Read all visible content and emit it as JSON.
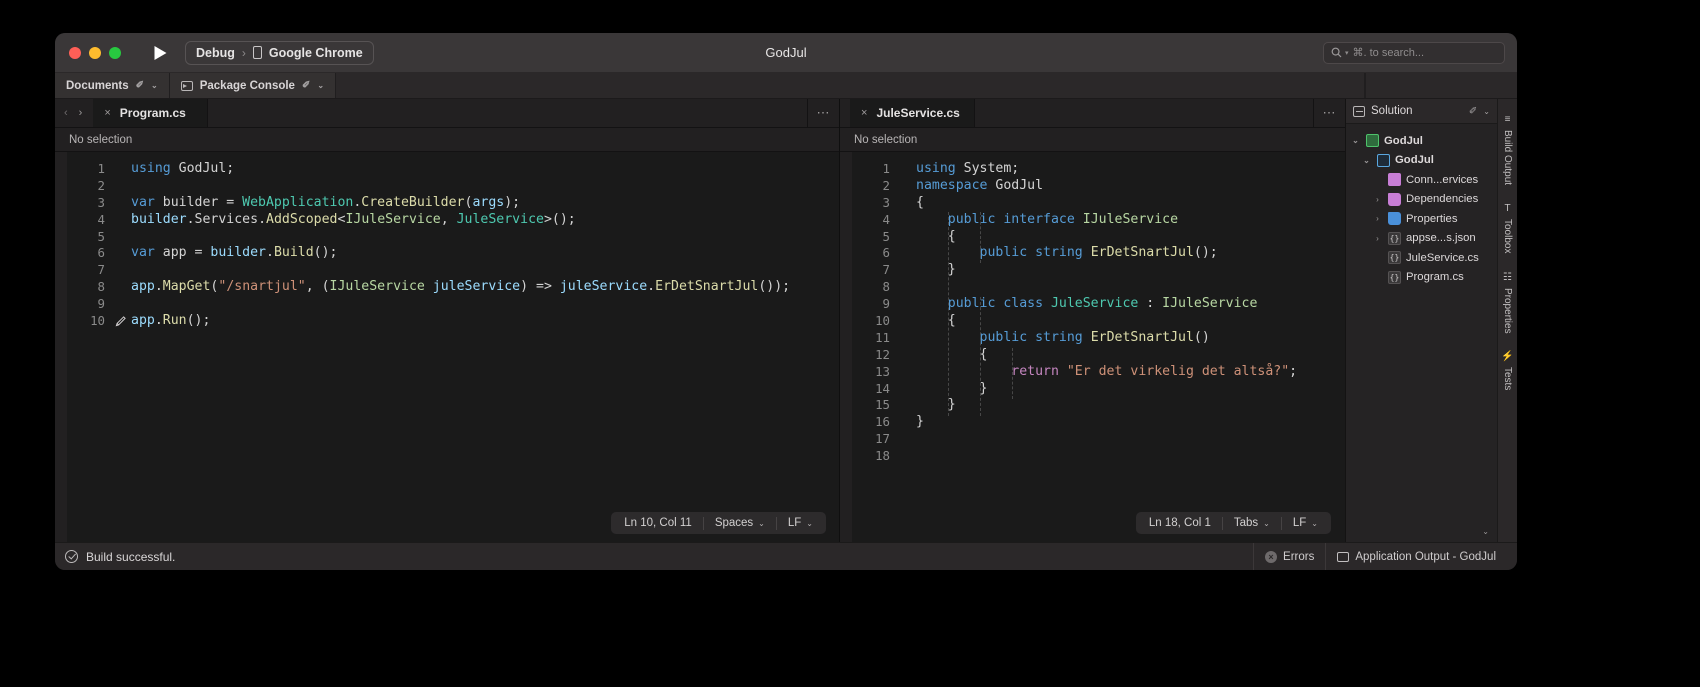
{
  "window": {
    "title": "GodJul",
    "run_button": "run-icon",
    "config": {
      "configuration": "Debug",
      "separator": "›",
      "target": "Google Chrome"
    },
    "search_placeholder": "⌘. to search..."
  },
  "pads": [
    {
      "label": "Documents",
      "icon": null,
      "pin": "✐",
      "chevron": "⌄"
    },
    {
      "label": "Package Console",
      "icon": "console-icon",
      "pin": "✐",
      "chevron": "⌄"
    }
  ],
  "panes": [
    {
      "tab": {
        "name": "Program.cs",
        "close": "×"
      },
      "breadcrumb": "No selection",
      "nav_back": "‹",
      "nav_forward": "›",
      "overflow": "⋯",
      "status": {
        "position": "Ln 10, Col 11",
        "indent": "Spaces",
        "eol": "LF",
        "chevron": "⌄"
      },
      "lines": [
        {
          "n": "1",
          "marker": "",
          "tokens": [
            {
              "t": "using ",
              "c": "kw"
            },
            {
              "t": "GodJul",
              "c": "pl"
            },
            {
              "t": ";",
              "c": "pl"
            }
          ]
        },
        {
          "n": "2",
          "marker": "",
          "tokens": []
        },
        {
          "n": "3",
          "marker": "",
          "tokens": [
            {
              "t": "var ",
              "c": "kw"
            },
            {
              "t": "builder",
              "c": "pl"
            },
            {
              "t": " = ",
              "c": "pl"
            },
            {
              "t": "WebApplication",
              "c": "typ"
            },
            {
              "t": ".",
              "c": "pl"
            },
            {
              "t": "CreateBuilder",
              "c": "mth"
            },
            {
              "t": "(",
              "c": "pl"
            },
            {
              "t": "args",
              "c": "par"
            },
            {
              "t": ");",
              "c": "pl"
            }
          ]
        },
        {
          "n": "4",
          "marker": "",
          "tokens": [
            {
              "t": "builder",
              "c": "par"
            },
            {
              "t": ".",
              "c": "pl"
            },
            {
              "t": "Services",
              "c": "pl"
            },
            {
              "t": ".",
              "c": "pl"
            },
            {
              "t": "AddScoped",
              "c": "mth"
            },
            {
              "t": "<",
              "c": "pl"
            },
            {
              "t": "IJuleService",
              "c": "ifc"
            },
            {
              "t": ", ",
              "c": "pl"
            },
            {
              "t": "JuleService",
              "c": "typ"
            },
            {
              "t": ">();",
              "c": "pl"
            }
          ]
        },
        {
          "n": "5",
          "marker": "",
          "tokens": []
        },
        {
          "n": "6",
          "marker": "",
          "tokens": [
            {
              "t": "var ",
              "c": "kw"
            },
            {
              "t": "app",
              "c": "pl"
            },
            {
              "t": " = ",
              "c": "pl"
            },
            {
              "t": "builder",
              "c": "par"
            },
            {
              "t": ".",
              "c": "pl"
            },
            {
              "t": "Build",
              "c": "mth"
            },
            {
              "t": "();",
              "c": "pl"
            }
          ]
        },
        {
          "n": "7",
          "marker": "",
          "tokens": []
        },
        {
          "n": "8",
          "marker": "",
          "tokens": [
            {
              "t": "app",
              "c": "par"
            },
            {
              "t": ".",
              "c": "pl"
            },
            {
              "t": "MapGet",
              "c": "mth"
            },
            {
              "t": "(",
              "c": "pl"
            },
            {
              "t": "\"/snartjul\"",
              "c": "str"
            },
            {
              "t": ", (",
              "c": "pl"
            },
            {
              "t": "IJuleService",
              "c": "ifc"
            },
            {
              "t": " ",
              "c": "pl"
            },
            {
              "t": "juleService",
              "c": "par"
            },
            {
              "t": ") => ",
              "c": "pl"
            },
            {
              "t": "juleService",
              "c": "par"
            },
            {
              "t": ".",
              "c": "pl"
            },
            {
              "t": "ErDetSnartJul",
              "c": "mth"
            },
            {
              "t": "());",
              "c": "pl"
            }
          ]
        },
        {
          "n": "9",
          "marker": "",
          "tokens": []
        },
        {
          "n": "10",
          "marker": "pencil-icon",
          "tokens": [
            {
              "t": "app",
              "c": "par"
            },
            {
              "t": ".",
              "c": "pl"
            },
            {
              "t": "Run",
              "c": "mth"
            },
            {
              "t": "();",
              "c": "pl"
            }
          ]
        }
      ]
    },
    {
      "tab": {
        "name": "JuleService.cs",
        "close": "×"
      },
      "breadcrumb": "No selection",
      "overflow": "⋯",
      "status": {
        "position": "Ln 18, Col 1",
        "indent": "Tabs",
        "eol": "LF",
        "chevron": "⌄"
      },
      "lines": [
        {
          "n": "1",
          "marker": "",
          "tokens": [
            {
              "t": "using ",
              "c": "kw"
            },
            {
              "t": "System",
              "c": "pl"
            },
            {
              "t": ";",
              "c": "pl"
            }
          ]
        },
        {
          "n": "2",
          "marker": "",
          "tokens": [
            {
              "t": "namespace ",
              "c": "kw"
            },
            {
              "t": "GodJul",
              "c": "pl"
            }
          ]
        },
        {
          "n": "3",
          "marker": "",
          "tokens": [
            {
              "t": "{",
              "c": "pl"
            }
          ]
        },
        {
          "n": "4",
          "marker": "",
          "tokens": [
            {
              "t": "    ",
              "c": "pl"
            },
            {
              "t": "public ",
              "c": "kw"
            },
            {
              "t": "interface ",
              "c": "kw"
            },
            {
              "t": "IJuleService",
              "c": "ifc"
            }
          ]
        },
        {
          "n": "5",
          "marker": "",
          "tokens": [
            {
              "t": "    {",
              "c": "pl"
            }
          ]
        },
        {
          "n": "6",
          "marker": "",
          "tokens": [
            {
              "t": "        ",
              "c": "pl"
            },
            {
              "t": "public ",
              "c": "kw"
            },
            {
              "t": "string ",
              "c": "kw"
            },
            {
              "t": "ErDetSnartJul",
              "c": "mth"
            },
            {
              "t": "();",
              "c": "pl"
            }
          ]
        },
        {
          "n": "7",
          "marker": "",
          "tokens": [
            {
              "t": "    }",
              "c": "pl"
            }
          ]
        },
        {
          "n": "8",
          "marker": "",
          "tokens": []
        },
        {
          "n": "9",
          "marker": "",
          "tokens": [
            {
              "t": "    ",
              "c": "pl"
            },
            {
              "t": "public ",
              "c": "kw"
            },
            {
              "t": "class ",
              "c": "kw"
            },
            {
              "t": "JuleService",
              "c": "typ"
            },
            {
              "t": " : ",
              "c": "pl"
            },
            {
              "t": "IJuleService",
              "c": "ifc"
            }
          ]
        },
        {
          "n": "10",
          "marker": "",
          "tokens": [
            {
              "t": "    {",
              "c": "pl"
            }
          ]
        },
        {
          "n": "11",
          "marker": "",
          "tokens": [
            {
              "t": "        ",
              "c": "pl"
            },
            {
              "t": "public ",
              "c": "kw"
            },
            {
              "t": "string ",
              "c": "kw"
            },
            {
              "t": "ErDetSnartJul",
              "c": "mth"
            },
            {
              "t": "()",
              "c": "pl"
            }
          ]
        },
        {
          "n": "12",
          "marker": "",
          "tokens": [
            {
              "t": "        {",
              "c": "pl"
            }
          ]
        },
        {
          "n": "13",
          "marker": "",
          "tokens": [
            {
              "t": "            ",
              "c": "pl"
            },
            {
              "t": "return ",
              "c": "kw2"
            },
            {
              "t": "\"Er det virkelig det altså?\"",
              "c": "str"
            },
            {
              "t": ";",
              "c": "pl"
            }
          ]
        },
        {
          "n": "14",
          "marker": "",
          "tokens": [
            {
              "t": "        }",
              "c": "pl"
            }
          ]
        },
        {
          "n": "15",
          "marker": "",
          "tokens": [
            {
              "t": "    }",
              "c": "pl"
            }
          ]
        },
        {
          "n": "16",
          "marker": "",
          "tokens": [
            {
              "t": "}",
              "c": "pl"
            }
          ]
        },
        {
          "n": "17",
          "marker": "",
          "tokens": []
        },
        {
          "n": "18",
          "marker": "",
          "tokens": []
        }
      ]
    }
  ],
  "solution": {
    "title": "Solution",
    "pin": "✐",
    "chevron": "⌄",
    "collapse_glyph": "⌄",
    "tree": [
      {
        "label": "GodJul",
        "icon": "solution-icon",
        "twisty": "⌄",
        "depth": 0,
        "bold": true
      },
      {
        "label": "GodJul",
        "icon": "project-icon",
        "twisty": "⌄",
        "depth": 1,
        "bold": true
      },
      {
        "label": "Conn...ervices",
        "icon": "connected-services-icon",
        "twisty": "",
        "depth": 2,
        "bold": false
      },
      {
        "label": "Dependencies",
        "icon": "dependencies-icon",
        "twisty": "›",
        "depth": 2,
        "bold": false
      },
      {
        "label": "Properties",
        "icon": "properties-folder-icon",
        "twisty": "›",
        "depth": 2,
        "bold": false
      },
      {
        "label": "appse...s.json",
        "icon": "json-file-icon",
        "twisty": "›",
        "depth": 2,
        "bold": false
      },
      {
        "label": "JuleService.cs",
        "icon": "csharp-file-icon",
        "twisty": "",
        "depth": 2,
        "bold": false
      },
      {
        "label": "Program.cs",
        "icon": "csharp-file-icon",
        "twisty": "",
        "depth": 2,
        "bold": false
      }
    ]
  },
  "rail": [
    {
      "label": "Build Output",
      "glyph": "≡"
    },
    {
      "label": "Toolbox",
      "glyph": "T"
    },
    {
      "label": "Properties",
      "glyph": "☷"
    },
    {
      "label": "Tests",
      "glyph": "⚡"
    }
  ],
  "statusbar": {
    "build_message": "Build successful.",
    "build_icon": "check-circle-icon",
    "errors_label": "Errors",
    "errors_icon": "error-circle-icon",
    "output_label": "Application Output - GodJul",
    "output_icon": "output-window-icon"
  }
}
